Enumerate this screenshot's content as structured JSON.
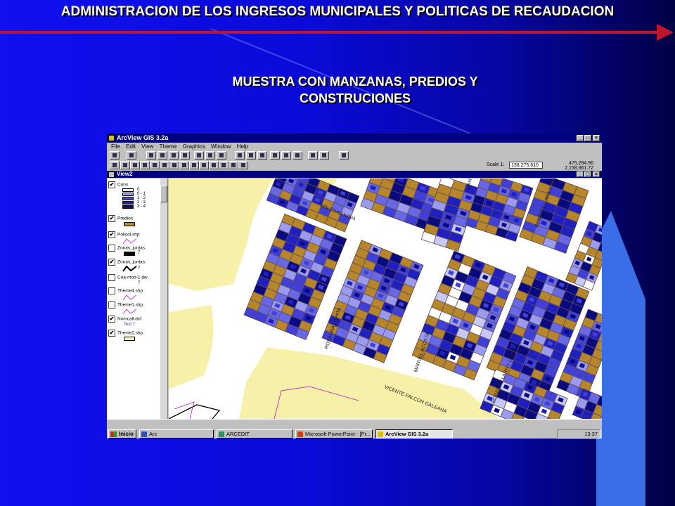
{
  "slide": {
    "title": "ADMINISTRACION DE LOS INGRESOS MUNICIPALES Y POLITICAS DE RECAUDACION",
    "subtitle_line1": "MUESTRA CON MANZANAS, PREDIOS Y",
    "subtitle_line2": "CONSTRUCIONES"
  },
  "app": {
    "window_title": "ArcView GIS 3.2a",
    "menu": [
      "File",
      "Edit",
      "View",
      "Theme",
      "Graphics",
      "Window",
      "Help"
    ],
    "scale_label": "Scale 1:",
    "scale_value": "138,275,610",
    "coord_x": "475,294.96",
    "coord_y": "2,158,661.72",
    "view_title": "View2"
  },
  "legend": {
    "cons": {
      "name": "Cons",
      "classes": [
        "0",
        "0 - 1",
        "1 - 2",
        "2 - 3",
        "3 - 4"
      ],
      "colors": [
        "#ffffff",
        "#a0a0f0",
        "#5050e0",
        "#2020c0",
        "#0a0a80"
      ]
    },
    "themes": [
      {
        "name": "Predios",
        "checked": true
      },
      {
        "name": "Policol.shp",
        "checked": true
      },
      {
        "name": "Zonas_juntas.",
        "checked": false
      },
      {
        "name": "Zonas_juntas.",
        "checked": true
      },
      {
        "name": "Cua-mod-1.dw",
        "checked": false
      },
      {
        "name": "Theme4.shp",
        "checked": false
      },
      {
        "name": "Theme1.shp",
        "checked": false
      },
      {
        "name": "Nomcall.dxf",
        "checked": true
      },
      {
        "name": "Theme2.shp",
        "checked": true
      }
    ],
    "number_seven": "7",
    "text_label": "Text"
  },
  "map": {
    "streets": [
      "SOLEDAD NAVA",
      "ROSAURA ZAPATA",
      "MANUEL ACOSTA",
      "ROBERTO LARA Y LOPEZ",
      "VICENTE FALCON GALEANA",
      "ROBERTO LARA Y LO",
      "MAN"
    ],
    "colors": {
      "predio": "#b8862a",
      "street": "#ffffff",
      "open": "#f7f0a8"
    }
  },
  "taskbar": {
    "start": "Inicio",
    "tasks": [
      "Arc",
      "ARCEDIT",
      "Microsoft PowerPoint - [Pr...",
      "ArcView GIS 3.2a"
    ],
    "clock": "13:37"
  }
}
